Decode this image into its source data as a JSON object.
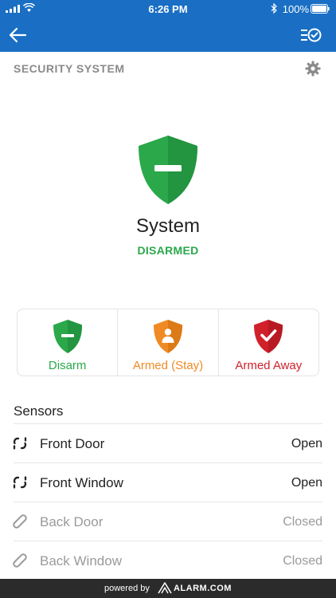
{
  "status_bar": {
    "time": "6:26 PM",
    "battery_percent": "100%"
  },
  "header": {
    "title": "SECURITY SYSTEM"
  },
  "system": {
    "name": "System",
    "status": "DISARMED",
    "status_color": "#2aa84a"
  },
  "modes": [
    {
      "label": "Disarm",
      "color": "#2aa84a",
      "icon": "shield-minus-icon"
    },
    {
      "label": "Armed (Stay)",
      "color": "#f08a24",
      "icon": "shield-person-icon"
    },
    {
      "label": "Armed Away",
      "color": "#d0202a",
      "icon": "shield-check-icon"
    }
  ],
  "sensors_title": "Sensors",
  "sensors": [
    {
      "name": "Front Door",
      "state": "Open",
      "icon": "broken-link-icon",
      "active": true
    },
    {
      "name": "Front Window",
      "state": "Open",
      "icon": "broken-link-icon",
      "active": true
    },
    {
      "name": "Back Door",
      "state": "Closed",
      "icon": "link-icon",
      "active": false
    },
    {
      "name": "Back Window",
      "state": "Closed",
      "icon": "link-icon",
      "active": false
    }
  ],
  "footer": {
    "powered_by": "powered by",
    "brand": "ALARM.COM"
  },
  "colors": {
    "header_bar": "#1a6fc4",
    "footer_bar": "#2b2b2b"
  }
}
